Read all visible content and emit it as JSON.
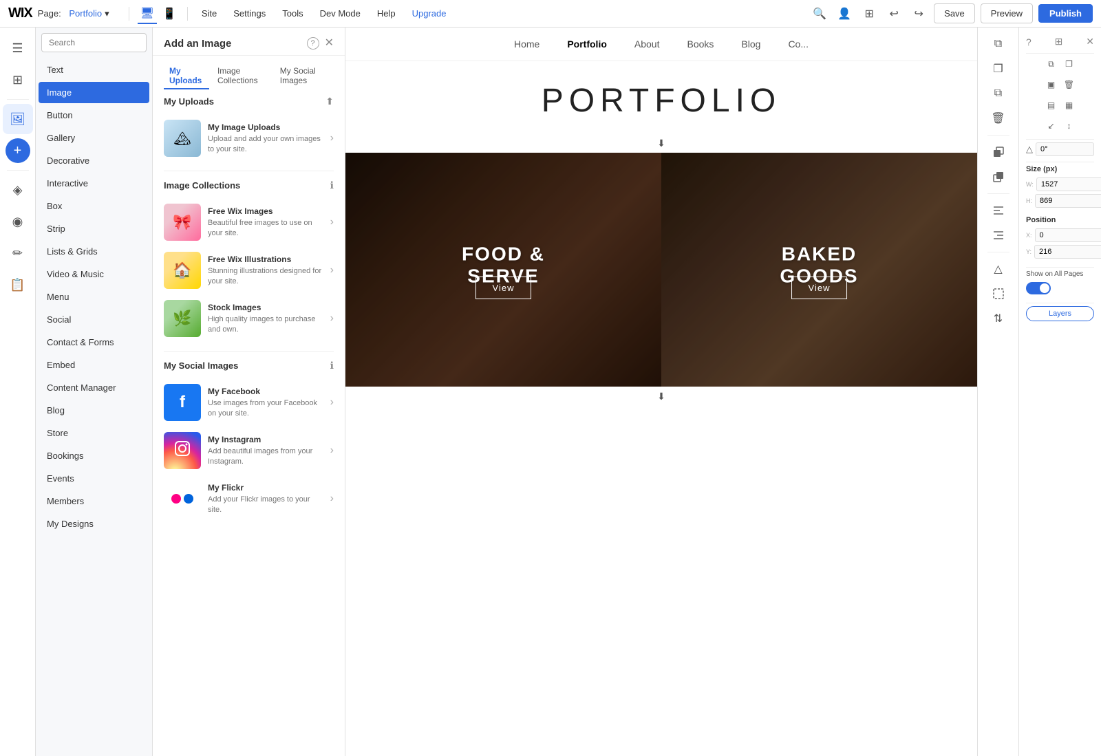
{
  "topbar": {
    "logo": "WIX",
    "page_label": "Page:",
    "page_name": "Portfolio",
    "nav_items": [
      "Site",
      "Settings",
      "Tools",
      "Dev Mode",
      "Help",
      "Upgrade"
    ],
    "save_label": "Save",
    "preview_label": "Preview",
    "publish_label": "Publish"
  },
  "left_sidebar": {
    "items": [
      {
        "id": "pages",
        "icon": "☰",
        "label": ""
      },
      {
        "id": "sections",
        "icon": "⊞",
        "label": ""
      },
      {
        "id": "image",
        "icon": "🖼",
        "label": "Image",
        "active": true
      },
      {
        "id": "add",
        "icon": "+",
        "label": ""
      },
      {
        "id": "wix-apps",
        "icon": "◈",
        "label": ""
      },
      {
        "id": "media",
        "icon": "◉",
        "label": ""
      },
      {
        "id": "pen",
        "icon": "✏",
        "label": ""
      },
      {
        "id": "blog",
        "icon": "📋",
        "label": ""
      }
    ]
  },
  "panel": {
    "search_placeholder": "Search",
    "items": [
      {
        "label": "Text"
      },
      {
        "label": "Image",
        "active": true
      },
      {
        "label": "Button"
      },
      {
        "label": "Gallery"
      },
      {
        "label": "Decorative"
      },
      {
        "label": "Interactive"
      },
      {
        "label": "Box"
      },
      {
        "label": "Strip"
      },
      {
        "label": "Lists & Grids"
      },
      {
        "label": "Video & Music"
      },
      {
        "label": "Menu"
      },
      {
        "label": "Social"
      },
      {
        "label": "Contact & Forms"
      },
      {
        "label": "Embed"
      },
      {
        "label": "Content Manager"
      },
      {
        "label": "Blog"
      },
      {
        "label": "Store"
      },
      {
        "label": "Bookings"
      },
      {
        "label": "Events"
      },
      {
        "label": "Members"
      },
      {
        "label": "My Designs"
      }
    ]
  },
  "modal": {
    "title": "Add an Image",
    "tabs": [
      {
        "label": "My Uploads",
        "active": true
      },
      {
        "label": "Image Collections"
      },
      {
        "label": "My Social Images"
      }
    ],
    "sections": [
      {
        "id": "my-uploads",
        "heading": "My Uploads",
        "items": [
          {
            "id": "my-image-uploads",
            "title": "My Image Uploads",
            "description": "Upload and add your own images to your site.",
            "thumb_type": "uploads"
          }
        ]
      },
      {
        "id": "image-collections",
        "heading": "Image Collections",
        "items": [
          {
            "id": "free-wix-images",
            "title": "Free Wix Images",
            "description": "Beautiful free images to use on your site.",
            "thumb_type": "free-wix"
          },
          {
            "id": "free-wix-illustrations",
            "title": "Free Wix Illustrations",
            "description": "Stunning illustrations designed for your site.",
            "thumb_type": "illustrations"
          },
          {
            "id": "stock-images",
            "title": "Stock Images",
            "description": "High quality images to purchase and own.",
            "thumb_type": "stock"
          }
        ]
      },
      {
        "id": "my-social-images",
        "heading": "My Social Images",
        "items": [
          {
            "id": "my-facebook",
            "title": "My Facebook",
            "description": "Use images from your Facebook on your site.",
            "thumb_type": "facebook"
          },
          {
            "id": "my-instagram",
            "title": "My Instagram",
            "description": "Add beautiful images from your Instagram.",
            "thumb_type": "instagram"
          },
          {
            "id": "my-flickr",
            "title": "My Flickr",
            "description": "Add your Flickr images to your site.",
            "thumb_type": "flickr"
          }
        ]
      }
    ]
  },
  "canvas": {
    "nav_items": [
      "Home",
      "Portfolio",
      "About",
      "Books",
      "Blog",
      "Co..."
    ],
    "portfolio_title": "PORTFOLIO",
    "cells": [
      {
        "id": "food",
        "label_line1": "FOOD &",
        "label_line2": "SERVE",
        "view_btn": "View",
        "bg_color": "#3a2a1a"
      },
      {
        "id": "baked",
        "label": "BAKED GOODS",
        "view_btn": "View",
        "bg_color": "#5a4030"
      }
    ]
  },
  "properties": {
    "section_size": "Size (px)",
    "w_label": "W:",
    "h_label": "H:",
    "w_value": "1527",
    "h_value": "869",
    "section_position": "Position",
    "x_label": "X:",
    "y_label": "Y:",
    "x_value": "0",
    "y_value": "216",
    "show_all_pages_label": "Show on All Pages",
    "layers_label": "Layers",
    "angle_value": "0°"
  },
  "right_panel": {
    "icons": [
      {
        "id": "copy1",
        "symbol": "⧉"
      },
      {
        "id": "copy2",
        "symbol": "❏"
      },
      {
        "id": "copy3",
        "symbol": "⧉"
      },
      {
        "id": "trash",
        "symbol": "🗑"
      },
      {
        "id": "layer-back",
        "symbol": "⬛"
      },
      {
        "id": "layer-front",
        "symbol": "▪"
      },
      {
        "id": "align-left",
        "symbol": "⟵"
      },
      {
        "id": "align-right",
        "symbol": "⟶"
      },
      {
        "id": "triangle",
        "symbol": "△"
      },
      {
        "id": "resize",
        "symbol": "⊠"
      },
      {
        "id": "crop",
        "symbol": "⊡"
      },
      {
        "id": "flip",
        "symbol": "⇅"
      }
    ]
  }
}
